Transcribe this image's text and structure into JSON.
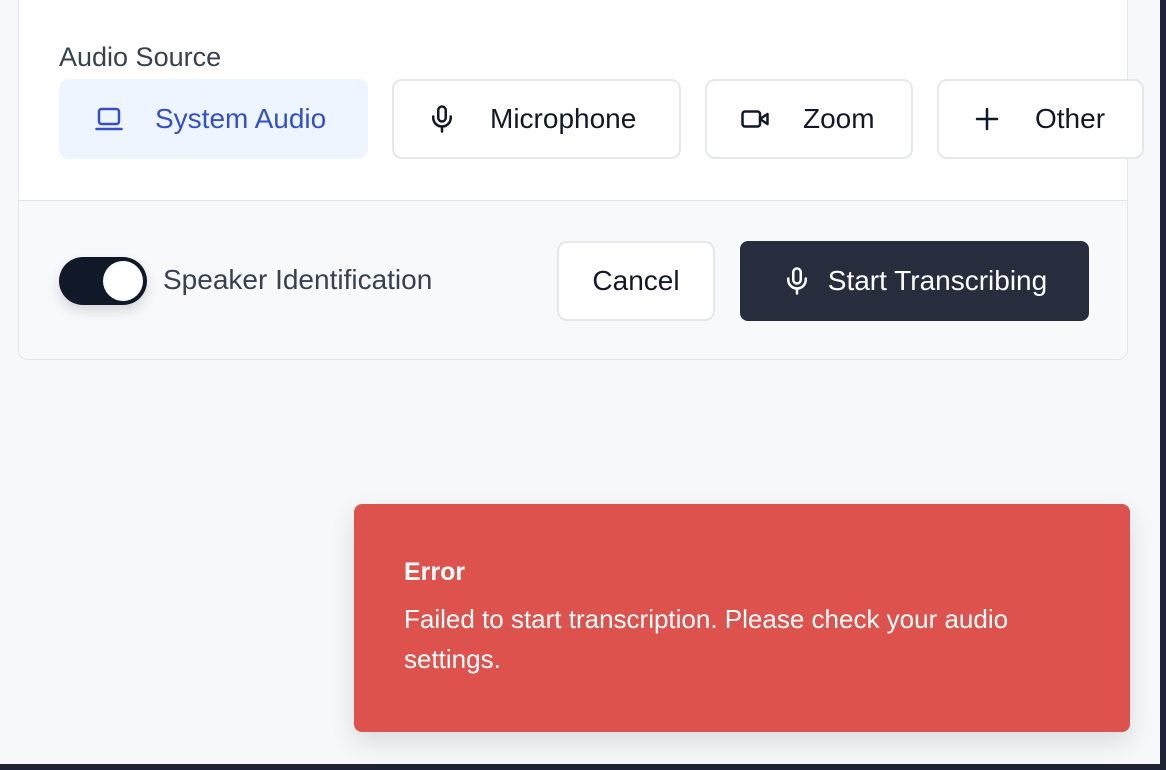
{
  "audio_source": {
    "label": "Audio Source",
    "options": [
      {
        "label": "System Audio",
        "icon": "laptop-icon",
        "selected": true
      },
      {
        "label": "Microphone",
        "icon": "microphone-icon",
        "selected": false
      },
      {
        "label": "Zoom",
        "icon": "video-camera-icon",
        "selected": false
      },
      {
        "label": "Other",
        "icon": "plus-icon",
        "selected": false
      }
    ]
  },
  "speaker_identification": {
    "label": "Speaker Identification",
    "enabled": true
  },
  "actions": {
    "cancel_label": "Cancel",
    "start_label": "Start Transcribing"
  },
  "toast": {
    "title": "Error",
    "message": "Failed to start transcription. Please check your audio settings."
  },
  "colors": {
    "accent": "#3450c6",
    "selected_bg": "#eef5ff",
    "primary_button": "#282d3e",
    "error": "#de524d"
  }
}
